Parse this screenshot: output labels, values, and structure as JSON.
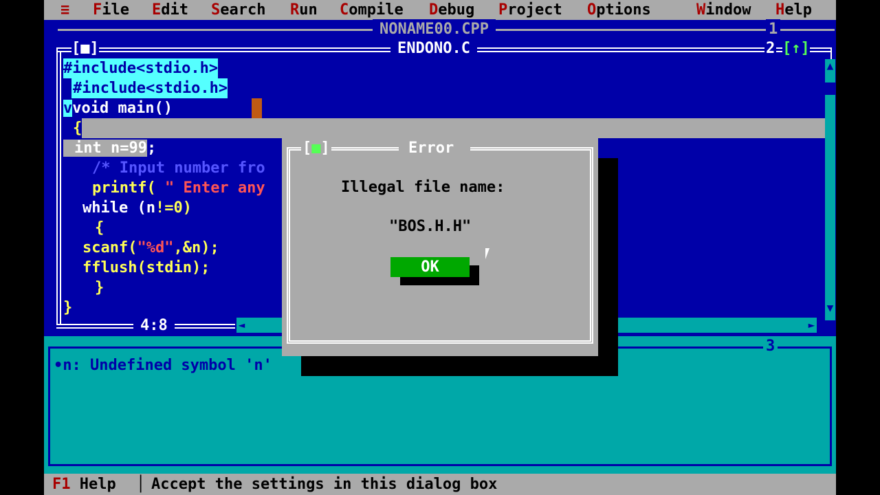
{
  "menubar": {
    "items": [
      {
        "hot": "≡",
        "rest": ""
      },
      {
        "hot": "F",
        "rest": "ile"
      },
      {
        "hot": "E",
        "rest": "dit"
      },
      {
        "hot": "S",
        "rest": "earch"
      },
      {
        "hot": "R",
        "rest": "un"
      },
      {
        "hot": "C",
        "rest": "ompile"
      },
      {
        "hot": "D",
        "rest": "ebug"
      },
      {
        "hot": "P",
        "rest": "roject"
      },
      {
        "hot": "O",
        "rest": "ptions"
      },
      {
        "hot": "W",
        "rest": "indow"
      },
      {
        "hot": "H",
        "rest": "elp"
      }
    ]
  },
  "back_window": {
    "title": "NONAME00.CPP",
    "number": "1"
  },
  "editor": {
    "title": "ENDONO.C",
    "close_box": "[■]",
    "number": "2",
    "zoom_box": "[↑]",
    "cursor_pos": "4:8",
    "lines": {
      "l1": "#include<stdio.h>",
      "l2": "#include<stdio.h>",
      "l3": "void main()",
      "l4": "{",
      "l5a": "int n=99",
      "l5b": ";",
      "l6": "/* Input number fro",
      "l7a": "printf(",
      "l7b": " \" Enter any",
      "l8a": "while (n",
      "l8b": "!",
      "l8c": "=0)",
      "l9": "{",
      "l10a": "scanf(",
      "l10b": "\"%d\"",
      "l10c": ",&n);",
      "l11": "fflush(stdin);",
      "l12": "}",
      "l13": "}"
    }
  },
  "message_window": {
    "number": "3",
    "text": "•n: Undefined symbol 'n'"
  },
  "dialog": {
    "close_box": "[■]",
    "title": "Error",
    "message": "Illegal file name:",
    "filename": "\"BOS.H.H\"",
    "ok_label": "OK"
  },
  "statusbar": {
    "key": "F1",
    "key_label": "Help",
    "message": "Accept the settings in this dialog box"
  }
}
